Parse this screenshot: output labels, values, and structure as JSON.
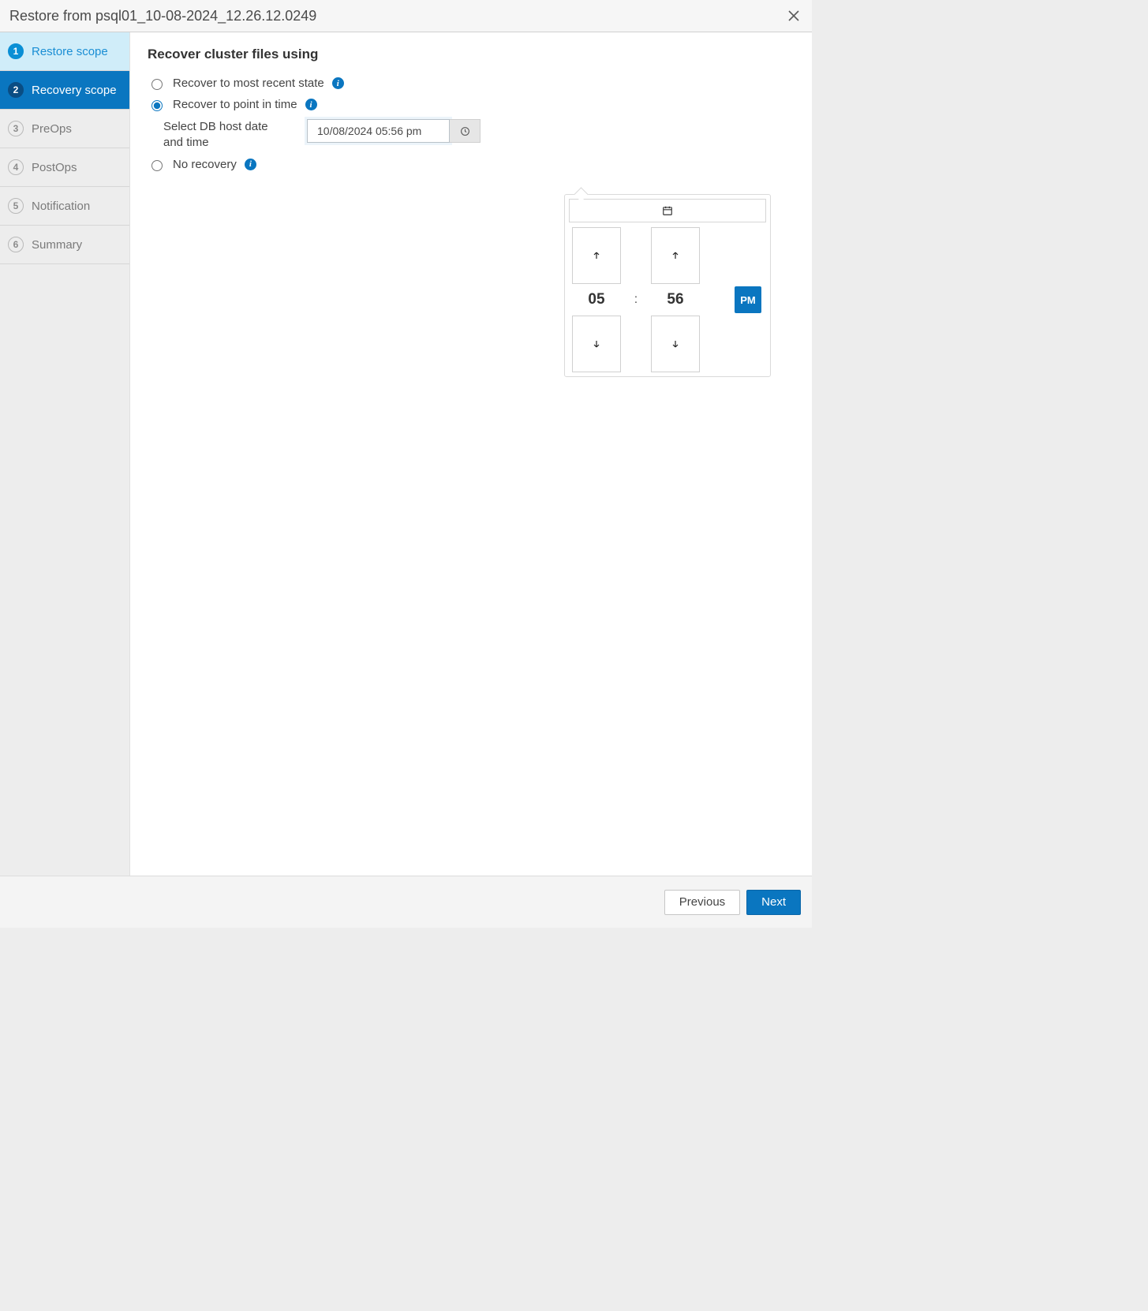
{
  "header": {
    "title": "Restore from psql01_10-08-2024_12.26.12.0249"
  },
  "sidebar": {
    "steps": [
      {
        "num": "1",
        "label": "Restore scope"
      },
      {
        "num": "2",
        "label": "Recovery scope"
      },
      {
        "num": "3",
        "label": "PreOps"
      },
      {
        "num": "4",
        "label": "PostOps"
      },
      {
        "num": "5",
        "label": "Notification"
      },
      {
        "num": "6",
        "label": "Summary"
      }
    ]
  },
  "content": {
    "heading": "Recover cluster files using",
    "options": {
      "recent": "Recover to most recent state",
      "pit": "Recover to point in time",
      "none": "No recovery"
    },
    "pit": {
      "sublabel": "Select DB host date and time",
      "value": "10/08/2024 05:56 pm"
    }
  },
  "picker": {
    "hour": "05",
    "minute": "56",
    "colon": ":",
    "ampm": "PM"
  },
  "footer": {
    "previous": "Previous",
    "next": "Next"
  }
}
